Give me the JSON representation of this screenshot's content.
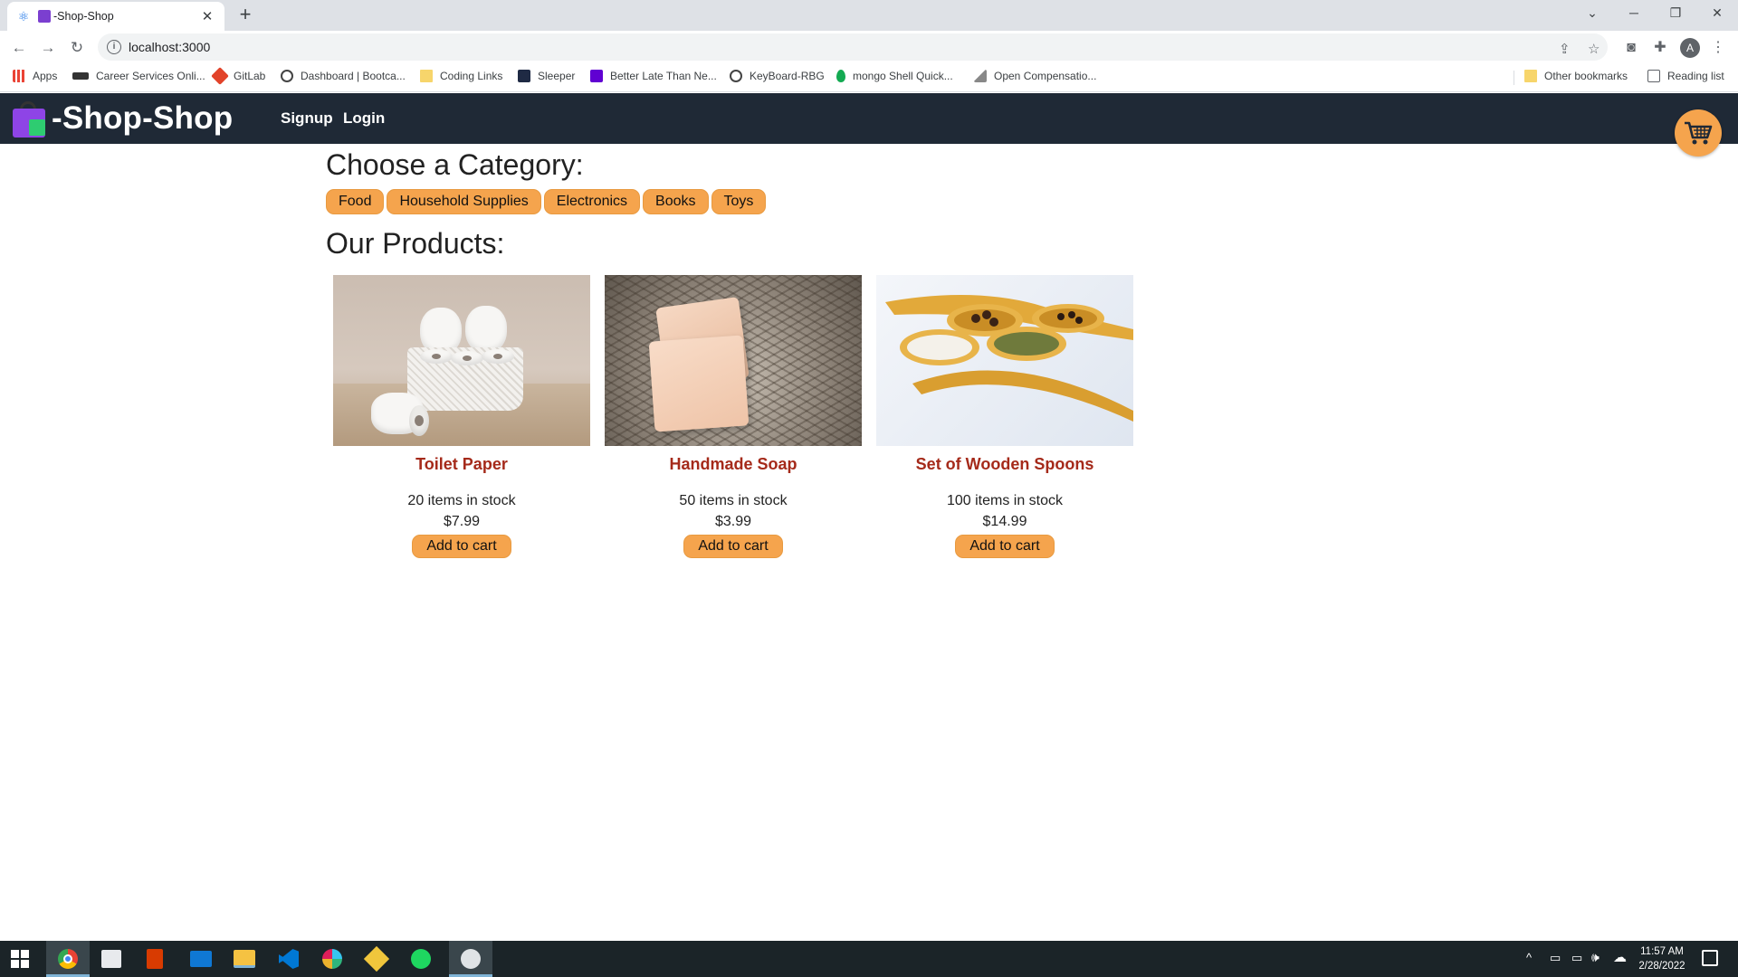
{
  "browser": {
    "tab_title": "-Shop-Shop",
    "url": "localhost:3000",
    "profile_initial": "A",
    "bookmarks": [
      "Apps",
      "Career Services Onli...",
      "GitLab",
      "Dashboard | Bootca...",
      "Coding Links",
      "Sleeper",
      "Better Late Than Ne...",
      "KeyBoard-RBG",
      "mongo Shell Quick...",
      "Open Compensatio..."
    ],
    "other_bookmarks": "Other bookmarks",
    "reading_list": "Reading list"
  },
  "site": {
    "logo_text": "-Shop-Shop",
    "nav": {
      "signup": "Signup",
      "login": "Login"
    }
  },
  "categories": {
    "heading": "Choose a Category:",
    "items": [
      "Food",
      "Household Supplies",
      "Electronics",
      "Books",
      "Toys"
    ]
  },
  "products": {
    "heading": "Our Products:",
    "items": [
      {
        "name": "Toilet Paper",
        "stock": "20 items in stock",
        "price": "$7.99",
        "button": "Add to cart"
      },
      {
        "name": "Handmade Soap",
        "stock": "50 items in stock",
        "price": "$3.99",
        "button": "Add to cart"
      },
      {
        "name": "Set of Wooden Spoons",
        "stock": "100 items in stock",
        "price": "$14.99",
        "button": "Add to cart"
      }
    ]
  },
  "taskbar": {
    "time": "11:57 AM",
    "date": "2/28/2022"
  },
  "colors": {
    "header_bg": "#1f2936",
    "accent": "#f5a44d",
    "product_name": "#a52a1a",
    "taskbar_bg": "#1b2428"
  }
}
